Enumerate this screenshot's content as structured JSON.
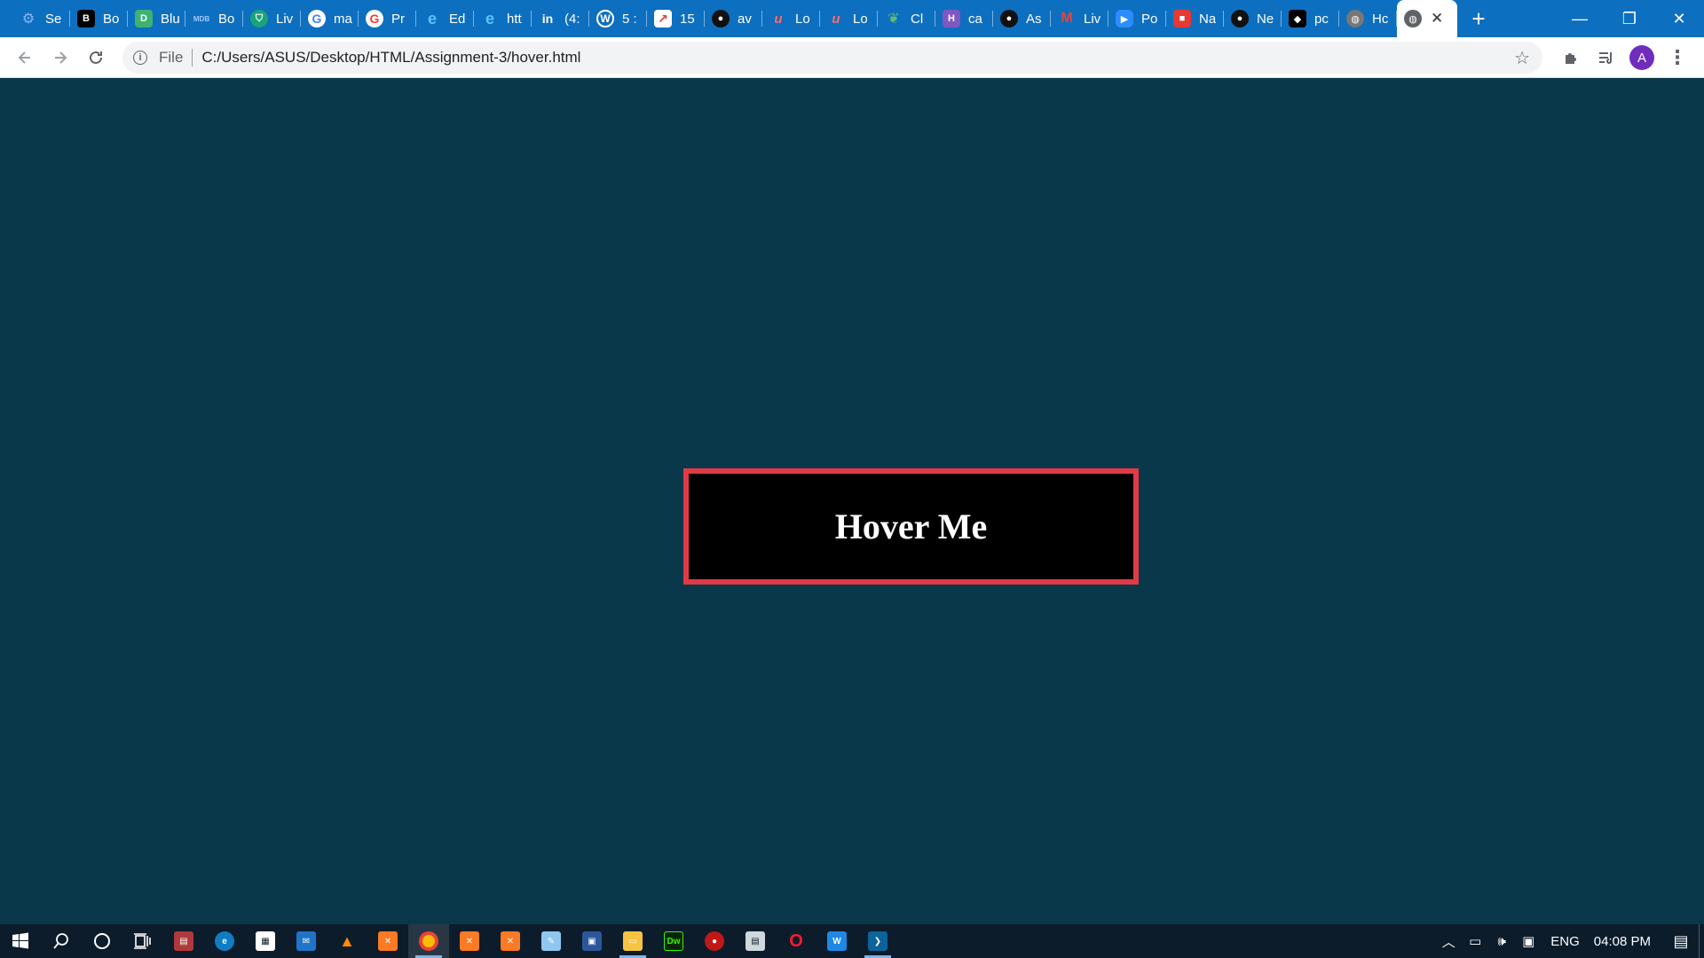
{
  "browser": {
    "tabs": [
      {
        "label": "Se",
        "icon": "settings-gear-icon",
        "color": "#1a73e8"
      },
      {
        "label": "Bo",
        "icon": "b-icon",
        "color": "#000000"
      },
      {
        "label": "Blu",
        "icon": "d-icon",
        "color": "#3cb371"
      },
      {
        "label": "Bo",
        "icon": "mdb-icon",
        "color": "#3b71ca"
      },
      {
        "label": "Liv",
        "icon": "shield-icon",
        "color": "#1aa37a"
      },
      {
        "label": "ma",
        "icon": "google-icon",
        "color": "#ffffff"
      },
      {
        "label": "Pr",
        "icon": "google-icon",
        "color": "#ea4335"
      },
      {
        "label": "Ed",
        "icon": "edge-icon",
        "color": "#1e88e5"
      },
      {
        "label": "htt",
        "icon": "edge-icon",
        "color": "#1e88e5"
      },
      {
        "label": "(4:",
        "icon": "linkedin-icon",
        "color": "#0a66c2"
      },
      {
        "label": "5 :",
        "icon": "wordpress-icon",
        "color": "#21759b"
      },
      {
        "label": "15",
        "icon": "arrow-icon",
        "color": "#e53935"
      },
      {
        "label": "av",
        "icon": "github-icon",
        "color": "#111111"
      },
      {
        "label": "Lo",
        "icon": "udemy-icon",
        "color": "#d32f2f"
      },
      {
        "label": "Lo",
        "icon": "udemy-icon",
        "color": "#d32f2f"
      },
      {
        "label": "Cl",
        "icon": "leaf-icon",
        "color": "#43a047"
      },
      {
        "label": "ca",
        "icon": "h-icon",
        "color": "#7e57c2"
      },
      {
        "label": "As",
        "icon": "github-icon",
        "color": "#111111"
      },
      {
        "label": "Liv",
        "icon": "gmail-icon",
        "color": "#ea4335"
      },
      {
        "label": "Po",
        "icon": "zoom-icon",
        "color": "#2d8cff"
      },
      {
        "label": "Na",
        "icon": "cube-icon",
        "color": "#e53935"
      },
      {
        "label": "Ne",
        "icon": "github-icon",
        "color": "#111111"
      },
      {
        "label": "pc",
        "icon": "puzzle-icon",
        "color": "#000000"
      },
      {
        "label": "Hc",
        "icon": "globe-icon",
        "color": "#777777"
      }
    ],
    "active_tab": {
      "icon": "globe-icon",
      "close": "✕"
    },
    "new_tab": "+",
    "window_controls": {
      "minimize": "—",
      "restore": "❐",
      "close": "✕"
    },
    "address": {
      "scheme": "File",
      "url": "C:/Users/ASUS/Desktop/HTML/Assignment-3/hover.html"
    },
    "profile_initial": "A"
  },
  "page": {
    "button_label": "Hover Me",
    "background": "#083849",
    "button_border_color": "#e13a45"
  },
  "taskbar": {
    "apps": [
      "windows-start-icon",
      "search-icon",
      "cortana-icon",
      "task-view-icon",
      "app-icon",
      "edge-icon",
      "store-icon",
      "mail-icon",
      "vlc-icon",
      "xampp-icon",
      "chrome-icon",
      "xampp-icon",
      "xampp-icon",
      "notepad-icon",
      "word-icon",
      "file-explorer-icon",
      "dreamweaver-icon",
      "app-icon",
      "app-icon",
      "opera-icon",
      "app-icon",
      "vscode-icon"
    ],
    "tray": {
      "language": "ENG",
      "time": "04:08 PM"
    }
  }
}
